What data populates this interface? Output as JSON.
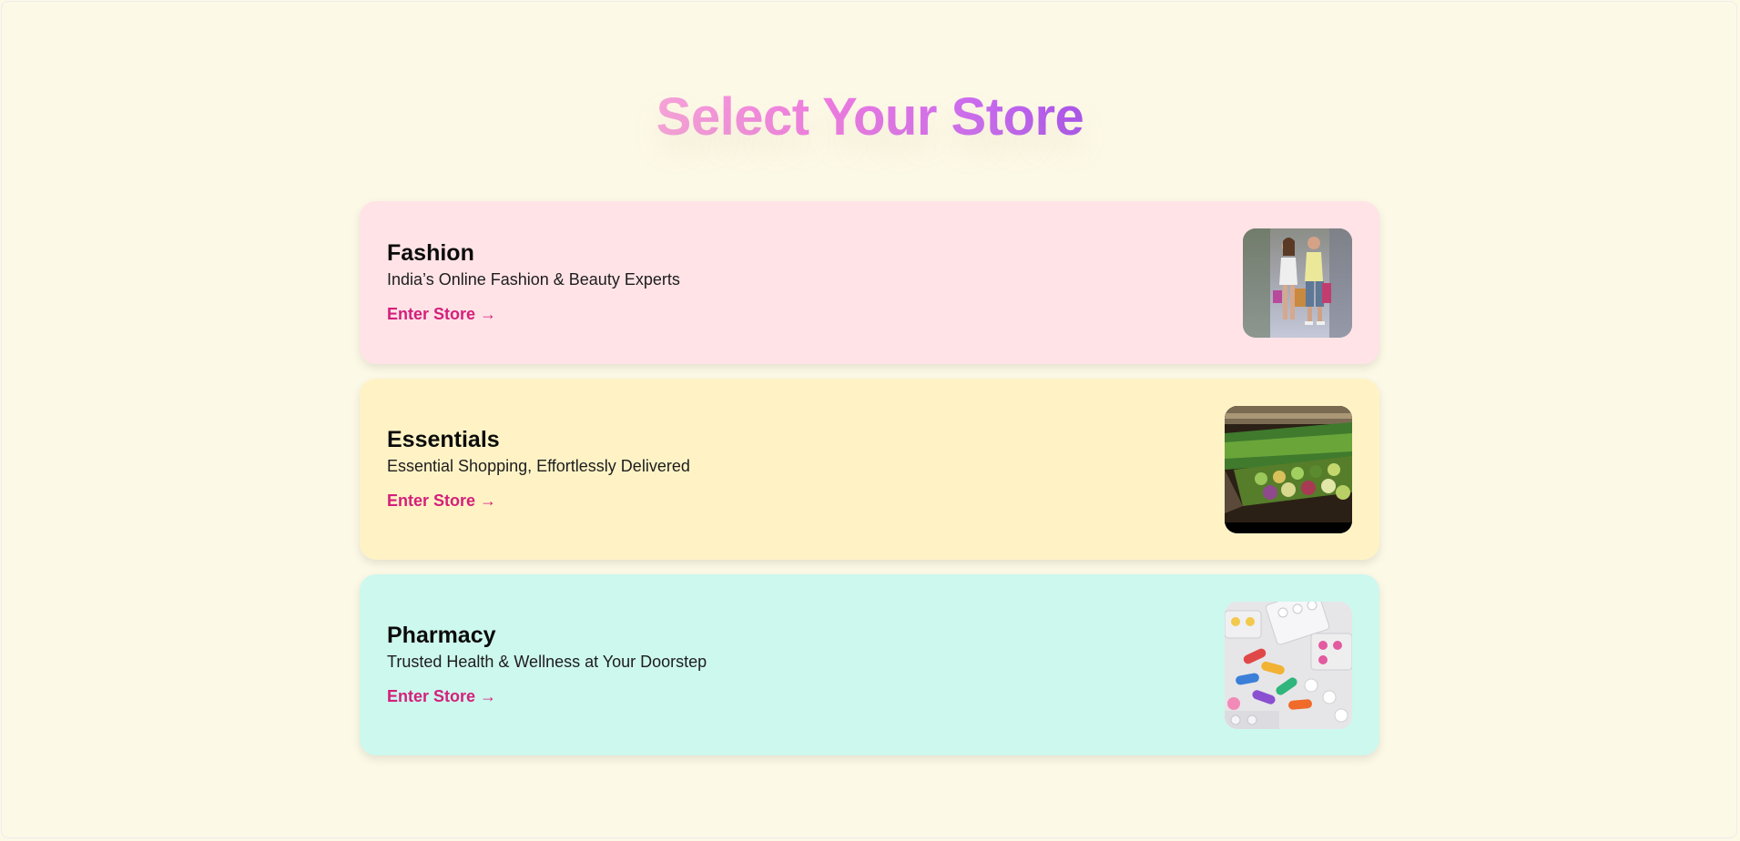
{
  "page": {
    "title": "Select Your Store"
  },
  "stores": [
    {
      "name": "Fashion",
      "description": "India’s Online Fashion & Beauty Experts",
      "link": "Enter Store →",
      "bg_color": "#ffe3e7",
      "image": "fashion-couple-shopping-image"
    },
    {
      "name": "Essentials",
      "description": "Essential Shopping, Effortlessly Delivered",
      "link": "Enter Store →",
      "bg_color": "#fff3c6",
      "image": "grocery-produce-aisle-image"
    },
    {
      "name": "Pharmacy",
      "description": "Trusted Health & Wellness at Your Doorstep",
      "link": "Enter Store →",
      "bg_color": "#cdf8ee",
      "image": "pills-and-capsules-image"
    }
  ],
  "colors": {
    "page_bg": "#fdf9e7",
    "link": "#d4207a",
    "title_gradient_start": "#f7a6d8",
    "title_gradient_end": "#a552e8"
  }
}
